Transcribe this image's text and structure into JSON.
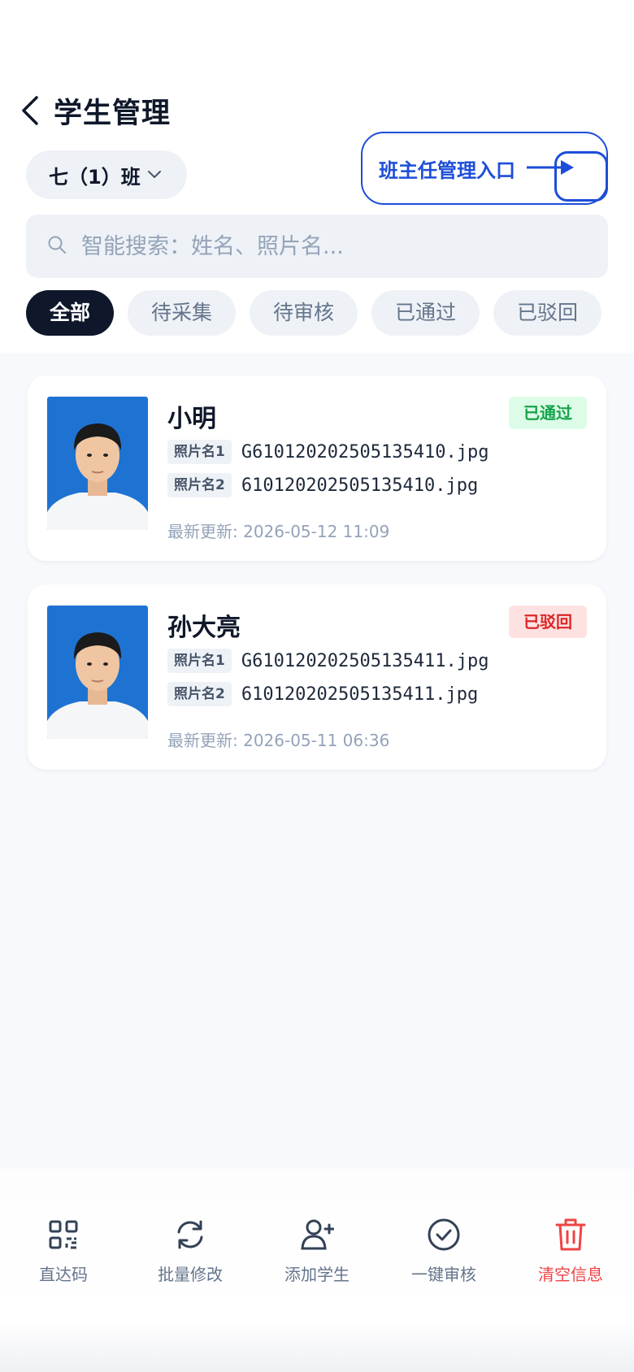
{
  "header": {
    "title": "学生管理"
  },
  "class_selector": {
    "value": "七（1）班"
  },
  "annotation": {
    "text": "班主任管理入口"
  },
  "search": {
    "placeholder": "智能搜索：姓名、照片名..."
  },
  "filters": [
    {
      "label": "全部",
      "active": true
    },
    {
      "label": "待采集",
      "active": false
    },
    {
      "label": "待审核",
      "active": false
    },
    {
      "label": "已通过",
      "active": false
    },
    {
      "label": "已驳回",
      "active": false
    }
  ],
  "students": [
    {
      "name": "小明",
      "status": "已通过",
      "file1_tag": "照片名1",
      "file1": "G610120202505135410.jpg",
      "file2_tag": "照片名2",
      "file2": "610120202505135410.jpg",
      "updated": "最新更新: 2026-05-12 11:09"
    },
    {
      "name": "孙大亮",
      "status": "已驳回",
      "file1_tag": "照片名1",
      "file1": "G610120202505135411.jpg",
      "file2_tag": "照片名2",
      "file2": "610120202505135411.jpg",
      "updated": "最新更新: 2026-05-11 06:36"
    }
  ],
  "actions": [
    {
      "label": "直达码",
      "icon": "qr-code-icon"
    },
    {
      "label": "批量修改",
      "icon": "refresh-icon"
    },
    {
      "label": "添加学生",
      "icon": "add-user-icon"
    },
    {
      "label": "一键审核",
      "icon": "check-circle-icon"
    },
    {
      "label": "清空信息",
      "icon": "trash-icon"
    }
  ],
  "colors": {
    "accent": "#1d4ed8",
    "dark": "#0f172a",
    "pass": "#16a34a",
    "reject": "#dc2626",
    "danger": "#ef4444",
    "photo_bg": "#1e73d2"
  }
}
